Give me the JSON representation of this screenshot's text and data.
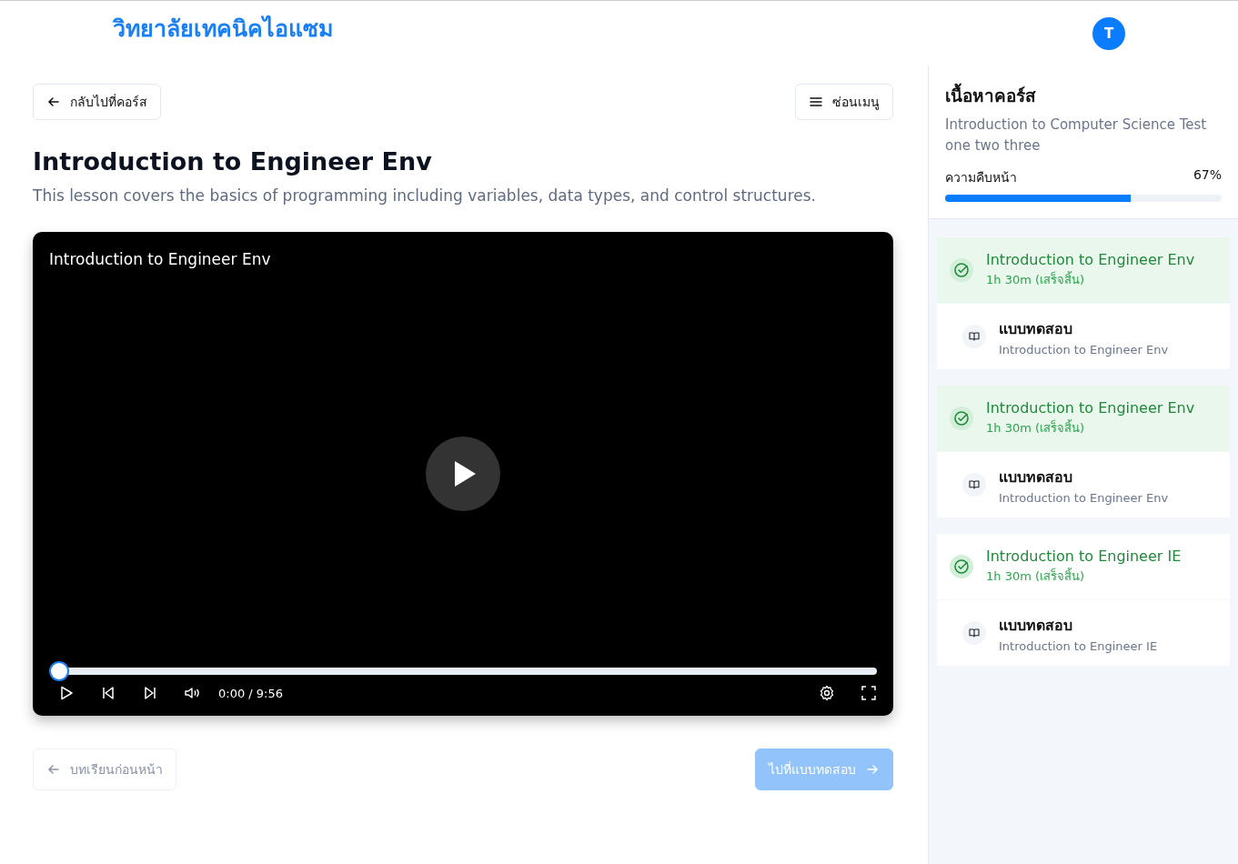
{
  "header": {
    "brand": "วิทยาลัยเทคนิคไอแซม",
    "avatar": "T"
  },
  "toolbar": {
    "back": "กลับไปที่คอร์ส",
    "menu": "ซ่อนเมนู"
  },
  "lesson": {
    "title": "Introduction to Engineer Env",
    "description": "This lesson covers the basics of programming including variables, data types, and control structures."
  },
  "video": {
    "title": "Introduction to Engineer Env",
    "level": 0,
    "time": "0:00 / 9:56"
  },
  "nav": {
    "previous": {
      "label": "บทเรียนก่อนหน้า",
      "disabled": true
    },
    "next": {
      "label": "ไปที่แบบทดสอบ",
      "disabled": true
    }
  },
  "sidebar": {
    "heading": "เนื้อหาคอร์ส",
    "course": "Introduction to Computer Science Test one two three",
    "progress_label": "ความคืบหน้า",
    "progress_value": "67%",
    "level": 0.67,
    "items": [
      {
        "kind": "lesson",
        "title": "Introduction to Engineer Env",
        "meta": "1h 30m (เสร็จสิ้น)",
        "selected": true
      },
      {
        "kind": "quiz",
        "title": "แบบทดสอบ",
        "meta": "Introduction to Engineer Env"
      },
      {
        "kind": "lesson",
        "title": "Introduction to Engineer Env",
        "meta": "1h 30m (เสร็จสิ้น)",
        "selected": true
      },
      {
        "kind": "quiz",
        "title": "แบบทดสอบ",
        "meta": "Introduction to Engineer Env"
      },
      {
        "kind": "lesson",
        "title": "Introduction to Engineer IE",
        "meta": "1h 30m (เสร็จสิ้น)",
        "selected": false
      },
      {
        "kind": "quiz",
        "title": "แบบทดสอบ",
        "meta": "Introduction to Engineer IE"
      }
    ]
  }
}
